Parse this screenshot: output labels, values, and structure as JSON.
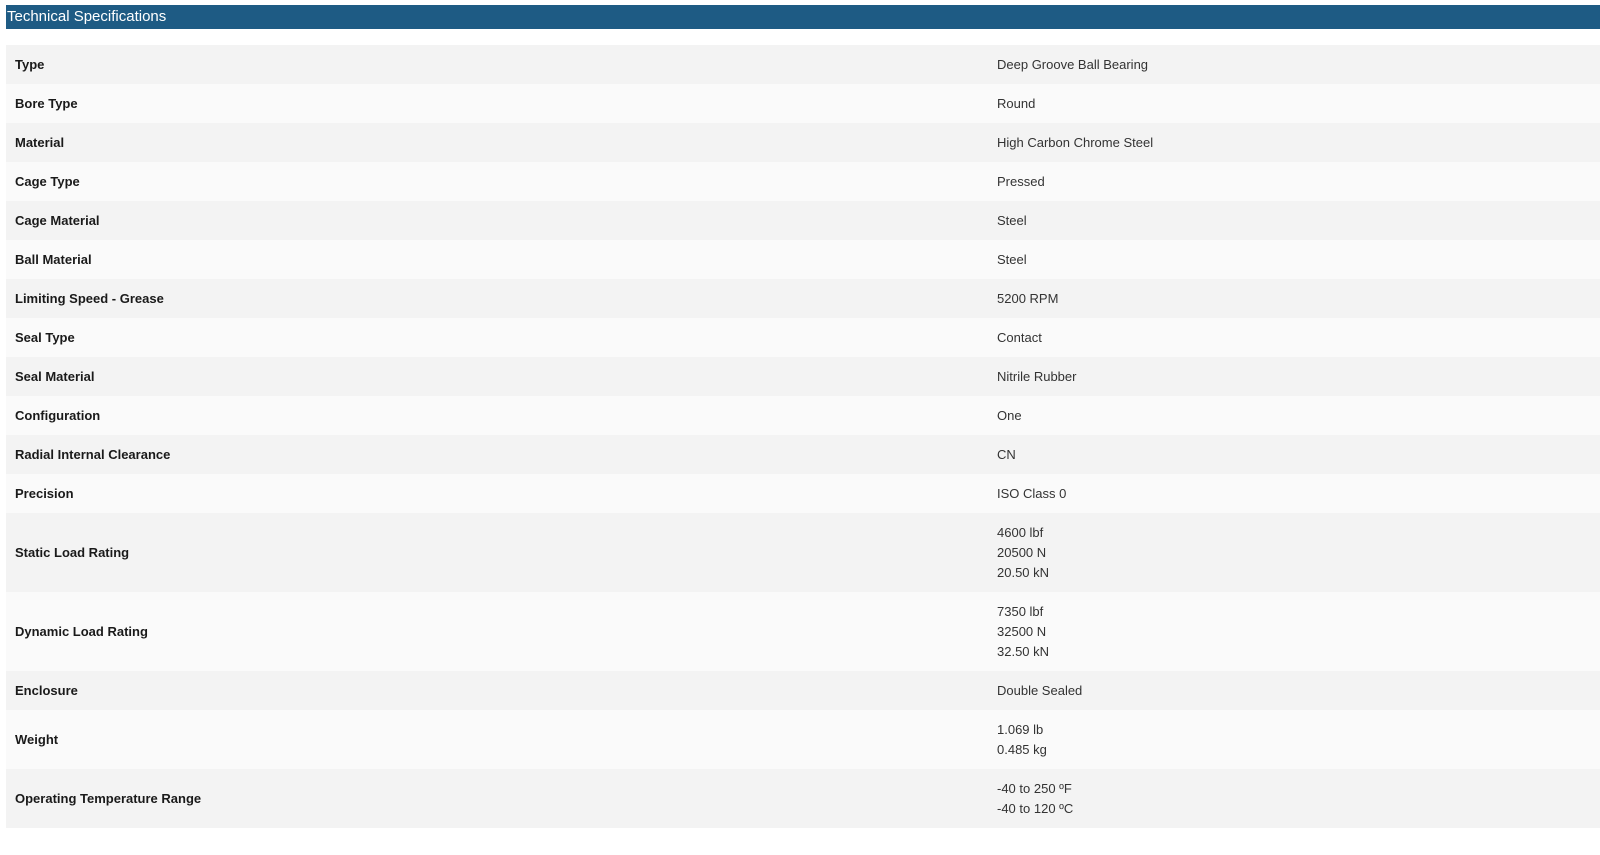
{
  "header": {
    "title": "Technical Specifications"
  },
  "specs": [
    {
      "label": "Type",
      "values": [
        "Deep Groove Ball Bearing"
      ]
    },
    {
      "label": "Bore Type",
      "values": [
        "Round"
      ]
    },
    {
      "label": "Material",
      "values": [
        "High Carbon Chrome Steel"
      ]
    },
    {
      "label": "Cage Type",
      "values": [
        "Pressed"
      ]
    },
    {
      "label": "Cage Material",
      "values": [
        "Steel"
      ]
    },
    {
      "label": "Ball Material",
      "values": [
        "Steel"
      ]
    },
    {
      "label": "Limiting Speed - Grease",
      "values": [
        "5200 RPM"
      ]
    },
    {
      "label": "Seal Type",
      "values": [
        "Contact"
      ]
    },
    {
      "label": "Seal Material",
      "values": [
        "Nitrile Rubber"
      ]
    },
    {
      "label": "Configuration",
      "values": [
        "One"
      ]
    },
    {
      "label": "Radial Internal Clearance",
      "values": [
        "CN"
      ]
    },
    {
      "label": "Precision",
      "values": [
        "ISO Class 0"
      ]
    },
    {
      "label": "Static Load Rating",
      "values": [
        "4600 lbf",
        "20500 N",
        "20.50 kN"
      ]
    },
    {
      "label": "Dynamic Load Rating",
      "values": [
        "7350 lbf",
        "32500 N",
        "32.50 kN"
      ]
    },
    {
      "label": "Enclosure",
      "values": [
        "Double Sealed"
      ]
    },
    {
      "label": "Weight",
      "values": [
        "1.069 lb",
        "0.485 kg"
      ]
    },
    {
      "label": "Operating Temperature Range",
      "values": [
        "-40 to 250 ºF",
        "-40 to 120 ºC"
      ]
    }
  ]
}
